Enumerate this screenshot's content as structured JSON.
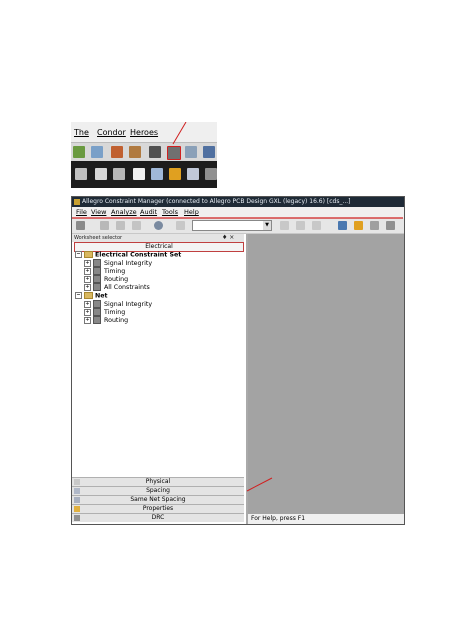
{
  "crop": {
    "menu": [
      "The",
      "Condor",
      "Heroes"
    ]
  },
  "window": {
    "title": "Allegro Constraint Manager (connected to Allegro PCB Design GXL (legacy) 16.6) [cds_...]",
    "menu": [
      "File",
      "View",
      "Analyze",
      "Audit",
      "Tools",
      "Help"
    ],
    "combo_value": ""
  },
  "panel": {
    "header": "Worksheet selector",
    "pin_controls": "♦ ×",
    "active_tab": "Electrical",
    "tree": {
      "section1": "Electrical Constraint Set",
      "section1_items": [
        "Signal Integrity",
        "Timing",
        "Routing",
        "All Constraints"
      ],
      "section2": "Net",
      "section2_items": [
        "Signal Integrity",
        "Timing",
        "Routing"
      ]
    },
    "bottom_tabs": [
      "Physical",
      "Spacing",
      "Same Net Spacing",
      "Properties",
      "DRC"
    ]
  },
  "status": {
    "text": "For Help, press F1"
  },
  "colors": {
    "title_bg": "#1e2a36",
    "workspace_bg": "#a3a3a3",
    "accent_red": "#d02020"
  }
}
